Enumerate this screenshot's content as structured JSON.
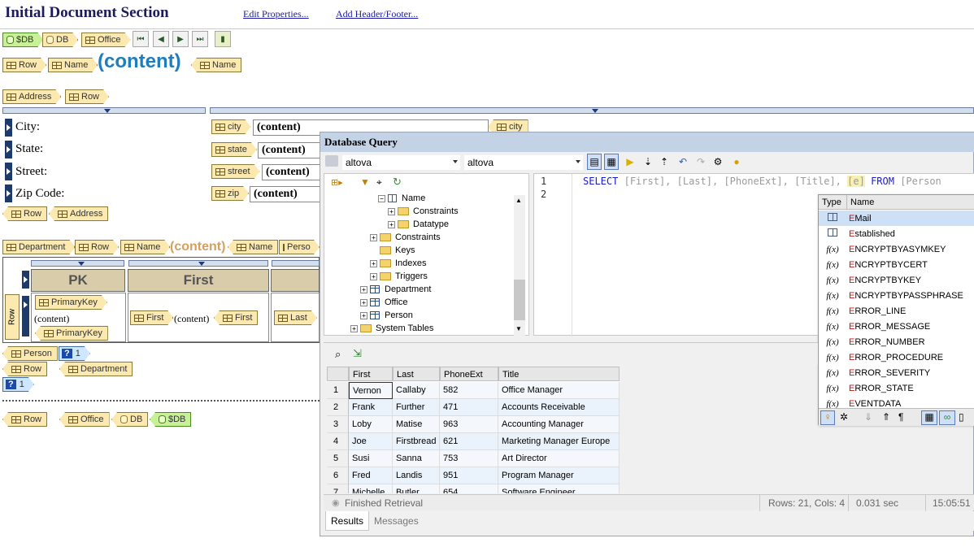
{
  "header": {
    "title": "Initial Document Section",
    "edit_properties": "Edit Properties...",
    "add_header_footer": "Add Header/Footer..."
  },
  "design": {
    "tag_sdb": "$DB",
    "tag_db": "DB",
    "tag_office": "Office",
    "tag_row": "Row",
    "tag_name": "Name",
    "content_big": "(content)",
    "tag_address": "Address",
    "city_label": "City:",
    "state_label": "State:",
    "street_label": "Street:",
    "zip_label": "Zip Code:",
    "tag_city": "city",
    "tag_state": "state",
    "tag_street": "street",
    "tag_zip": "zip",
    "content": "(content)",
    "tag_department": "Department",
    "tag_person": "Perso",
    "tag_person_full": "Person",
    "pk_header": "PK",
    "first_header": "First",
    "tag_primarykey": "PrimaryKey",
    "tag_first": "First",
    "tag_last": "Last",
    "row_vertical": "Row",
    "q_mark": "?",
    "one": "1"
  },
  "dbq": {
    "title": "Database Query",
    "combo1": "altova",
    "combo2": "altova",
    "tree": [
      {
        "label": "Name",
        "kind": "column",
        "indent": 66,
        "exp": "-"
      },
      {
        "label": "Constraints",
        "kind": "folder",
        "indent": 78,
        "exp": "+"
      },
      {
        "label": "Datatype",
        "kind": "folder",
        "indent": 78,
        "exp": "+"
      },
      {
        "label": "Constraints",
        "kind": "folder",
        "indent": 56,
        "exp": "+"
      },
      {
        "label": "Keys",
        "kind": "folder",
        "indent": 56,
        "exp": ""
      },
      {
        "label": "Indexes",
        "kind": "folder",
        "indent": 56,
        "exp": "+"
      },
      {
        "label": "Triggers",
        "kind": "folder",
        "indent": 56,
        "exp": "+"
      },
      {
        "label": "Department",
        "kind": "table",
        "indent": 44,
        "exp": "+"
      },
      {
        "label": "Office",
        "kind": "table",
        "indent": 44,
        "exp": "+"
      },
      {
        "label": "Person",
        "kind": "table",
        "indent": 44,
        "exp": "+"
      },
      {
        "label": "System Tables",
        "kind": "folder",
        "indent": 32,
        "exp": "+"
      }
    ],
    "sql_line1_num": "1",
    "sql_line2_num": "2",
    "sql_select": "SELECT",
    "sql_cols": "[First], [Last], [PhoneExt], [Title],",
    "sql_e": "[e]",
    "sql_from": "FROM",
    "sql_table": "[Person",
    "ac_type": "Type",
    "ac_name": "Name",
    "autocomplete": [
      {
        "t": "col",
        "first": "E",
        "rest": "Mail"
      },
      {
        "t": "col",
        "first": "E",
        "rest": "stablished"
      },
      {
        "t": "f(x)",
        "first": "E",
        "rest": "NCRYPTBYASYMKEY"
      },
      {
        "t": "f(x)",
        "first": "E",
        "rest": "NCRYPTBYCERT"
      },
      {
        "t": "f(x)",
        "first": "E",
        "rest": "NCRYPTBYKEY"
      },
      {
        "t": "f(x)",
        "first": "E",
        "rest": "NCRYPTBYPASSPHRASE"
      },
      {
        "t": "f(x)",
        "first": "E",
        "rest": "RROR_LINE"
      },
      {
        "t": "f(x)",
        "first": "E",
        "rest": "RROR_MESSAGE"
      },
      {
        "t": "f(x)",
        "first": "E",
        "rest": "RROR_NUMBER"
      },
      {
        "t": "f(x)",
        "first": "E",
        "rest": "RROR_PROCEDURE"
      },
      {
        "t": "f(x)",
        "first": "E",
        "rest": "RROR_SEVERITY"
      },
      {
        "t": "f(x)",
        "first": "E",
        "rest": "RROR_STATE"
      },
      {
        "t": "f(x)",
        "first": "E",
        "rest": "VENTDATA"
      }
    ],
    "grid_headers": [
      "First",
      "Last",
      "PhoneExt",
      "Title"
    ],
    "grid_rows": [
      [
        "1",
        "Vernon",
        "Callaby",
        "582",
        "Office Manager"
      ],
      [
        "2",
        "Frank",
        "Further",
        "471",
        "Accounts Receivable"
      ],
      [
        "3",
        "Loby",
        "Matise",
        "963",
        "Accounting Manager"
      ],
      [
        "4",
        "Joe",
        "Firstbread",
        "621",
        "Marketing Manager Europe"
      ],
      [
        "5",
        "Susi",
        "Sanna",
        "753",
        "Art Director"
      ],
      [
        "6",
        "Fred",
        "Landis",
        "951",
        "Program Manager"
      ],
      [
        "7",
        "Michelle",
        "Butler",
        "654",
        "Software Engineer"
      ]
    ],
    "status_text": "Finished Retrieval",
    "rows_cols": "Rows: 21, Cols: 4",
    "time": "0.031 sec",
    "clock": "15:05:51",
    "tab_results": "Results",
    "tab_messages": "Messages"
  }
}
